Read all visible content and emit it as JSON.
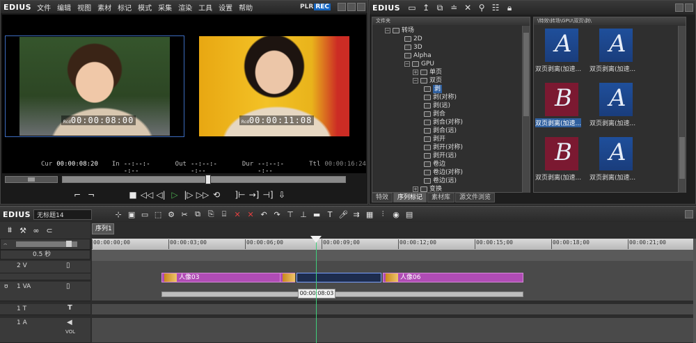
{
  "preview": {
    "brand": "EDIUS",
    "menu": [
      "文件",
      "编辑",
      "视图",
      "素材",
      "标记",
      "模式",
      "采集",
      "渲染",
      "工具",
      "设置",
      "帮助"
    ],
    "plr": "PLR",
    "rec": "REC",
    "tc_left": "00:00:08:00",
    "tc_right": "00:00:11:08",
    "rcd": "Rcd",
    "cur_label": "Cur",
    "cur_val": "00:00:08:20",
    "in_label": "In",
    "in_val": "--:--:--:--",
    "out_label": "Out",
    "out_val": "--:--:--:--",
    "dur_label": "Dur",
    "dur_val": "--:--:--:--",
    "ttl_label": "Ttl",
    "ttl_val": "00:00:16:24"
  },
  "bin": {
    "brand": "EDIUS",
    "tree_header": "文件夹",
    "path": "\\特效\\转场\\GPU\\双页\\剥\\",
    "tree": [
      {
        "label": "转场",
        "open": true,
        "folder": true
      },
      {
        "label": "2D"
      },
      {
        "label": "3D"
      },
      {
        "label": "Alpha"
      },
      {
        "label": "GPU",
        "open": true,
        "folder": true
      },
      {
        "label": "单页"
      },
      {
        "label": "双页",
        "open": true
      },
      {
        "label": "剥"
      },
      {
        "label": "剥(对称)"
      },
      {
        "label": "剥(远)"
      },
      {
        "label": "剥合"
      },
      {
        "label": "剥合(对称)"
      },
      {
        "label": "剥合(远)"
      },
      {
        "label": "剥开"
      },
      {
        "label": "剥开(对称)"
      },
      {
        "label": "剥开(远)"
      },
      {
        "label": "卷边"
      },
      {
        "label": "卷边(对称)"
      },
      {
        "label": "卷边(远)"
      },
      {
        "label": "变换"
      }
    ],
    "thumbs": [
      {
        "letter": "A",
        "label": "双页剥离(加速..."
      },
      {
        "letter": "A",
        "label": "双页剥离(加速..."
      },
      {
        "letter": "B",
        "label": "双页剥离(加速..."
      },
      {
        "letter": "A",
        "label": "双页剥离(加速..."
      },
      {
        "letter": "B",
        "label": "双页剥离(加速..."
      },
      {
        "letter": "A",
        "label": "双页剥离(加速..."
      }
    ],
    "tabs": [
      "特效",
      "序列标记",
      "素材库",
      "源文件浏览"
    ]
  },
  "timeline": {
    "brand": "EDIUS",
    "project": "无标题14",
    "sequence_tab": "序列1",
    "zoom": "0.5 秒",
    "ruler": [
      "00:00:00;00",
      "00:00:03;00",
      "00:00:06;00",
      "00:00:09;00",
      "00:00:12;00",
      "00:00:15;00",
      "00:00:18;00",
      "00:00:21;00"
    ],
    "tracks": {
      "v2": "2 V",
      "va1": "1 VA",
      "t1": "1 T",
      "a1": "1 A",
      "vol": "VOL"
    },
    "clip_a": "人像03",
    "clip_b": "人像06",
    "tooltip": "00:00:08:03"
  }
}
